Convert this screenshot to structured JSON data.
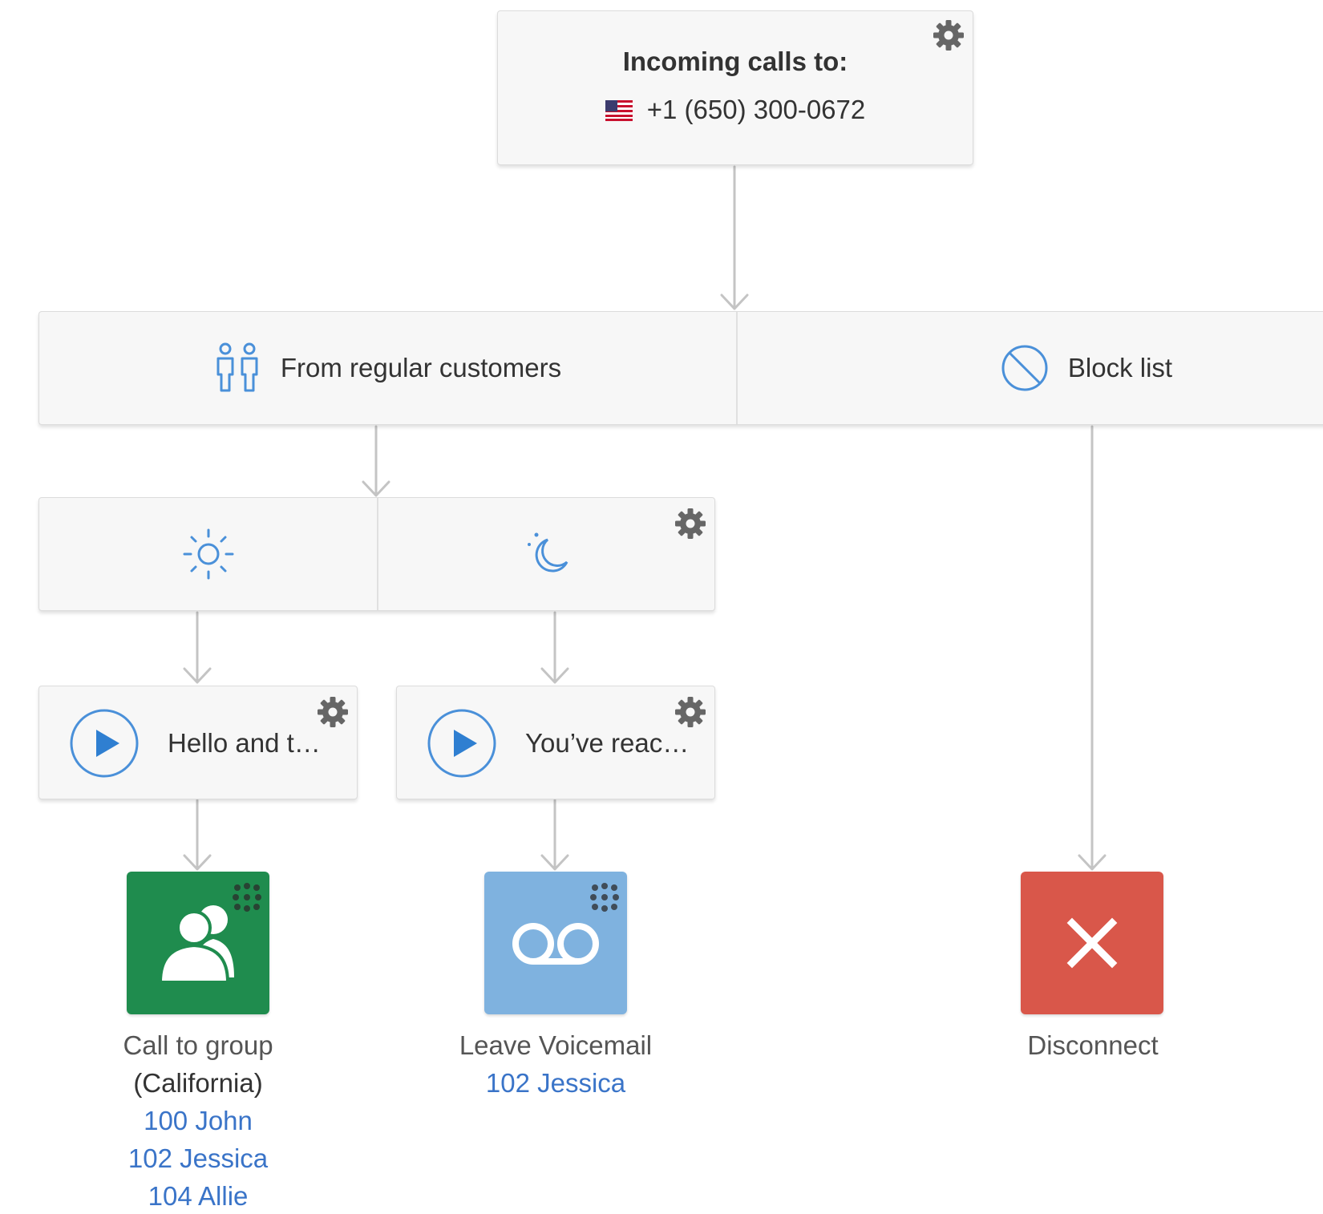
{
  "incoming": {
    "title": "Incoming calls to:",
    "number": "+1 (650) 300-0672",
    "flag_icon": "us-flag-icon"
  },
  "rules": [
    {
      "label": "From regular customers",
      "icon": "users-icon"
    },
    {
      "label": "Block list",
      "icon": "block-icon"
    }
  ],
  "time_conditions": [
    {
      "icon": "sun-icon"
    },
    {
      "icon": "moon-icon"
    }
  ],
  "messages": [
    {
      "label": "Hello and t…",
      "icon": "play-icon"
    },
    {
      "label": "You’ve reac…",
      "icon": "play-icon"
    }
  ],
  "actions": [
    {
      "title": "Call to group",
      "subtitle": "(California)",
      "icon": "group-icon",
      "color": "#1f8c4e",
      "members": [
        "100 John",
        "102 Jessica",
        "104 Allie"
      ]
    },
    {
      "title": "Leave Voicemail",
      "icon": "voicemail-icon",
      "color": "#7fb2df",
      "members": [
        "102 Jessica"
      ]
    },
    {
      "title": "Disconnect",
      "icon": "close-icon",
      "color": "#d9574a"
    }
  ],
  "colors": {
    "accent_blue": "#4a90d9",
    "link_blue": "#3a74c8",
    "connector": "#c4c4c4",
    "gear": "#666666"
  }
}
